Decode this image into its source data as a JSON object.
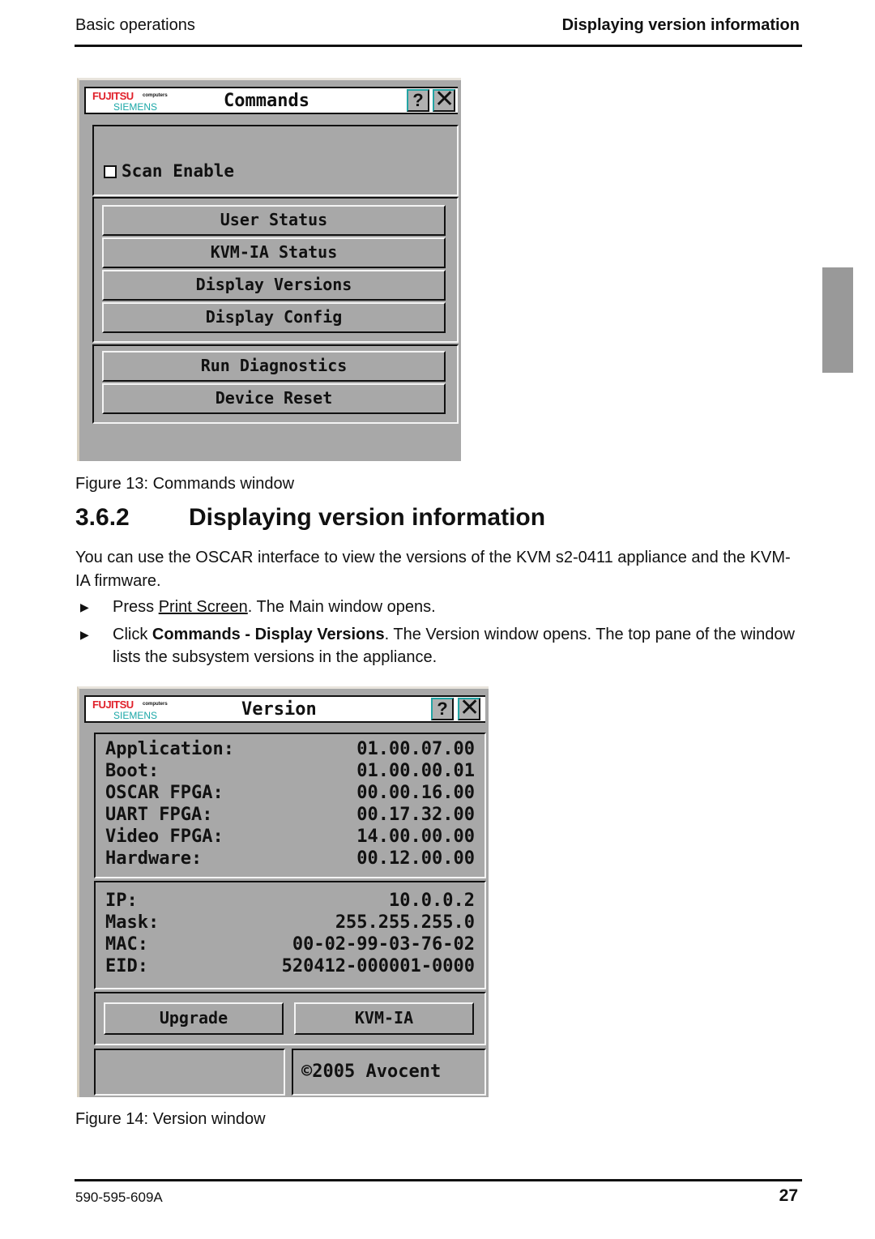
{
  "header": {
    "section": "Basic operations",
    "topic": "Displaying version information"
  },
  "figure13": {
    "window_title": "Commands",
    "logo": {
      "brand_top": "FUJITSU",
      "brand_small": "computers",
      "brand_bottom": "SIEMENS"
    },
    "help_button": "?",
    "close_button": "✕",
    "scan_enable": {
      "label": "Scan Enable",
      "checked": false
    },
    "buttons_group1": [
      "User Status",
      "KVM-IA Status",
      "Display Versions",
      "Display Config"
    ],
    "buttons_group2": [
      "Run Diagnostics",
      "Device Reset"
    ],
    "caption": "Figure 13: Commands window"
  },
  "section": {
    "number": "3.6.2",
    "title": "Displaying version information",
    "intro": "You can use the OSCAR interface to view the versions of the KVM s2-0411 appliance and the KVM-IA firmware.",
    "steps": [
      {
        "pre": "Press ",
        "link": "Print Screen",
        "post": ". The Main window opens."
      },
      {
        "pre": "Click ",
        "bold": "Commands - Display Versions",
        "post": ". The Version window opens. The top pane of the window lists the subsystem versions in the appliance."
      }
    ]
  },
  "figure14": {
    "window_title": "Version",
    "logo": {
      "brand_top": "FUJITSU",
      "brand_small": "computers",
      "brand_bottom": "SIEMENS"
    },
    "help_button": "?",
    "close_button": "✕",
    "versions": [
      {
        "label": "Application:",
        "value": "01.00.07.00"
      },
      {
        "label": "Boot:",
        "value": "01.00.00.01"
      },
      {
        "label": "OSCAR FPGA:",
        "value": "00.00.16.00"
      },
      {
        "label": "UART FPGA:",
        "value": "00.17.32.00"
      },
      {
        "label": "Video FPGA:",
        "value": "14.00.00.00"
      },
      {
        "label": "Hardware:",
        "value": "00.12.00.00"
      }
    ],
    "network": [
      {
        "label": "IP:",
        "value": "10.0.0.2"
      },
      {
        "label": "Mask:",
        "value": "255.255.255.0"
      },
      {
        "label": "MAC:",
        "value": "00-02-99-03-76-02"
      },
      {
        "label": "EID:",
        "value": "520412-000001-0000"
      }
    ],
    "upgrade_button": "Upgrade",
    "kvmia_button": "KVM-IA",
    "copyright": "©2005 Avocent",
    "caption": "Figure 14: Version window"
  },
  "footer": {
    "doc_number": "590-595-609A",
    "page_number": "27"
  }
}
